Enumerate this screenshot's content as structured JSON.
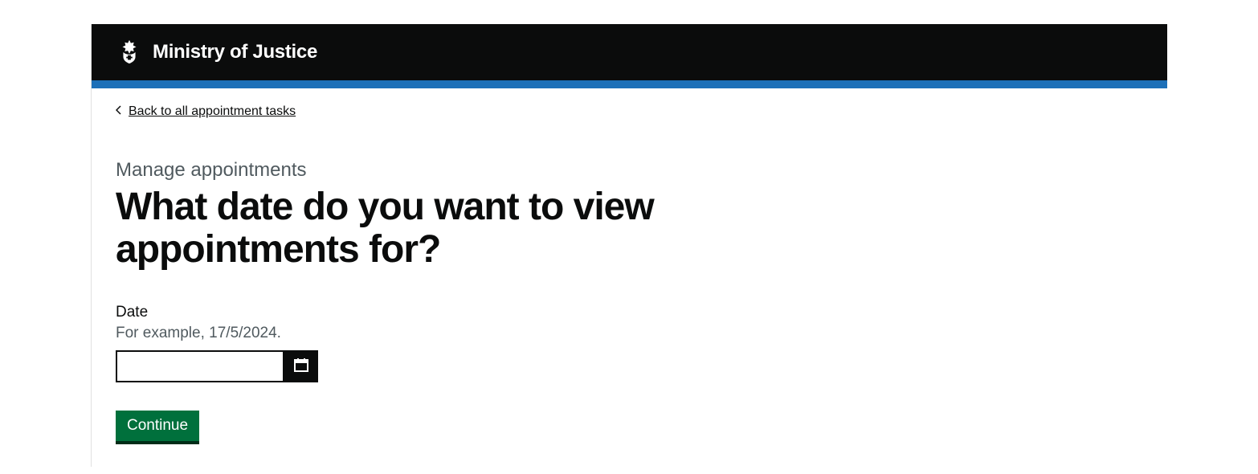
{
  "header": {
    "org_name": "Ministry of Justice"
  },
  "nav": {
    "back_link": "Back to all appointment tasks"
  },
  "page": {
    "caption": "Manage appointments",
    "heading": "What date do you want to view appointments for?"
  },
  "form": {
    "date_label": "Date",
    "date_hint": "For example, 17/5/2024.",
    "date_value": "",
    "continue_label": "Continue"
  }
}
